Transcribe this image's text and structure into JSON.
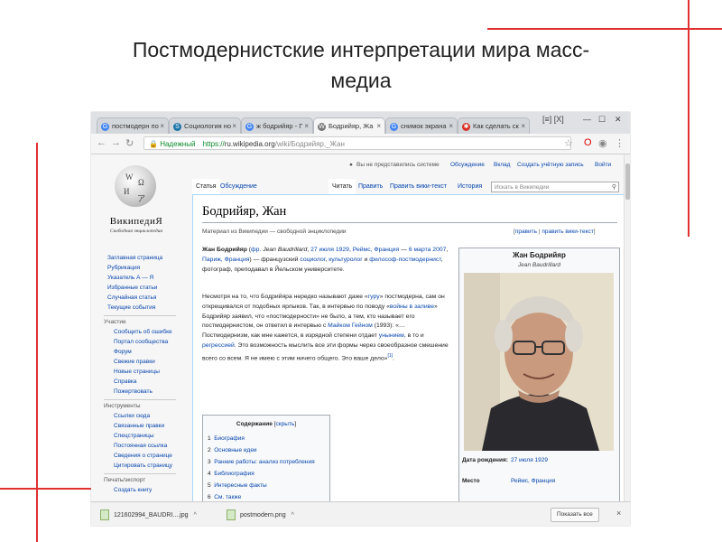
{
  "slide": {
    "title_line1": "Постмодернистские интерпретации мира масс-",
    "title_line2": "медиа",
    "accent_color": "#e03030"
  },
  "browser": {
    "tabs": [
      {
        "label": "постмодерн по",
        "icon": "google-icon"
      },
      {
        "label": "Социология но",
        "icon": "studfiles-icon"
      },
      {
        "label": "ж бодрийяр - Г",
        "icon": "google-icon"
      },
      {
        "label": "Бодрийяр, Жа",
        "icon": "wikipedia-icon"
      },
      {
        "label": "снимок экрана",
        "icon": "google-icon"
      },
      {
        "label": "Как сделать ск",
        "icon": "bookmark-icon"
      }
    ],
    "window_label": "[≡] [X]",
    "close_glyph": "×",
    "secure_label": "Надежный",
    "url_scheme": "https://",
    "url_host": "ru.wikipedia.org",
    "url_path": "/wiki/Бодрийяр,_Жан"
  },
  "wiki": {
    "user_links": [
      "Вы не представились системе",
      "Обсуждение",
      "Вклад",
      "Создать учётную запись",
      "Войти"
    ],
    "logo_name": "ВикипедиЯ",
    "logo_sub": "Свободная энциклопедия",
    "nav_main": [
      "Заглавная страница",
      "Рубрикация",
      "Указатель А — Я",
      "Избранные статьи",
      "Случайная статья",
      "Текущие события"
    ],
    "section_participation": "Участие",
    "nav_participation": [
      "Сообщить об ошибке",
      "Портал сообщества",
      "Форум",
      "Свежие правки",
      "Новые страницы",
      "Справка",
      "Пожертвовать"
    ],
    "section_tools": "Инструменты",
    "nav_tools": [
      "Ссылки сюда",
      "Связанные правки",
      "Спецстраницы",
      "Постоянная ссылка",
      "Сведения о странице",
      "Цитировать страницу"
    ],
    "section_print": "Печать/экспорт",
    "nav_print": [
      "Создать книгу"
    ],
    "tabs_left": [
      "Статья",
      "Обсуждение"
    ],
    "tabs_right": [
      "Читать",
      "Править",
      "Править вики-текст",
      "История"
    ],
    "search_placeholder": "Искать в Википедии",
    "title": "Бодрийяр, Жан",
    "from_line": "Материал из Википедии — свободной энциклопедии",
    "edit_links": {
      "edit": "править",
      "sep": " | ",
      "edit_source": "править вики-текст"
    },
    "para1": {
      "name_bold": "Жан Бодрийяр",
      "open": " (",
      "lang_fr": "фр.",
      "native": " Jean Baudrillard",
      "comma1": ", ",
      "birth": "27 июля 1929",
      "comma2": ", ",
      "birth_place": "Реймс, Франция",
      "dash": " — ",
      "death": "6 марта 2007",
      "comma3": ", ",
      "death_place": "Париж, Франция",
      "close": ") — французский ",
      "link1": "социолог",
      "comma4": ", ",
      "link2": "культуролог",
      "and": " и ",
      "link3": "философ-постмодернист",
      "rest": ", фотограф, преподавал в Йельском университете."
    },
    "para2": {
      "t1": "Несмотря на то, что Бодрийяра нередко называют даже «",
      "guru": "гуру",
      "t2": "» постмодерна, сам он открещивался от подобных ярлыков. Так, в интервью по поводу «",
      "war": "войны в заливе",
      "t3": "» Бодрийяр заявил, что «постмодерности» не было, а тем, кто называет его постмодернистом, он ответил в интервью с ",
      "gane": "Майком Гейном",
      "t4": " (1993): «…Постмодернизм, как мне кажется, в изрядной степени отдает ",
      "nihil": "унынием",
      "t5": ", в то и ",
      "regr": "регрессией",
      "t6": ". Это возможность мыслить все эти формы через своеобразное смешение всего со всем. Я не имею с этим ничего общего. Это ваше дело»",
      "ref": "[1]",
      "end": "."
    },
    "toc": {
      "title": "Содержание",
      "hide": "скрыть",
      "items": [
        {
          "num": "1",
          "label": "Биография"
        },
        {
          "num": "2",
          "label": "Основные идеи"
        },
        {
          "num": "3",
          "label": "Ранние работы: анализ потребления"
        },
        {
          "num": "4",
          "label": "Библиография"
        },
        {
          "num": "5",
          "label": "Интересные факты"
        },
        {
          "num": "6",
          "label": "См. также"
        }
      ]
    },
    "infobox": {
      "name": "Жан Бодрийяр",
      "native": "Jean Baudrillard",
      "birth_label": "Дата рождения:",
      "birth_value": "27 июля 1929",
      "place_label": "Место",
      "place_value": "Реймс, Франция"
    }
  },
  "downloads": {
    "items": [
      {
        "name": "121602994_BAUDRI....jpg",
        "arrow": "^"
      },
      {
        "name": "postmodern.png",
        "arrow": "^"
      }
    ],
    "show_all": "Показать все",
    "close": "×"
  }
}
